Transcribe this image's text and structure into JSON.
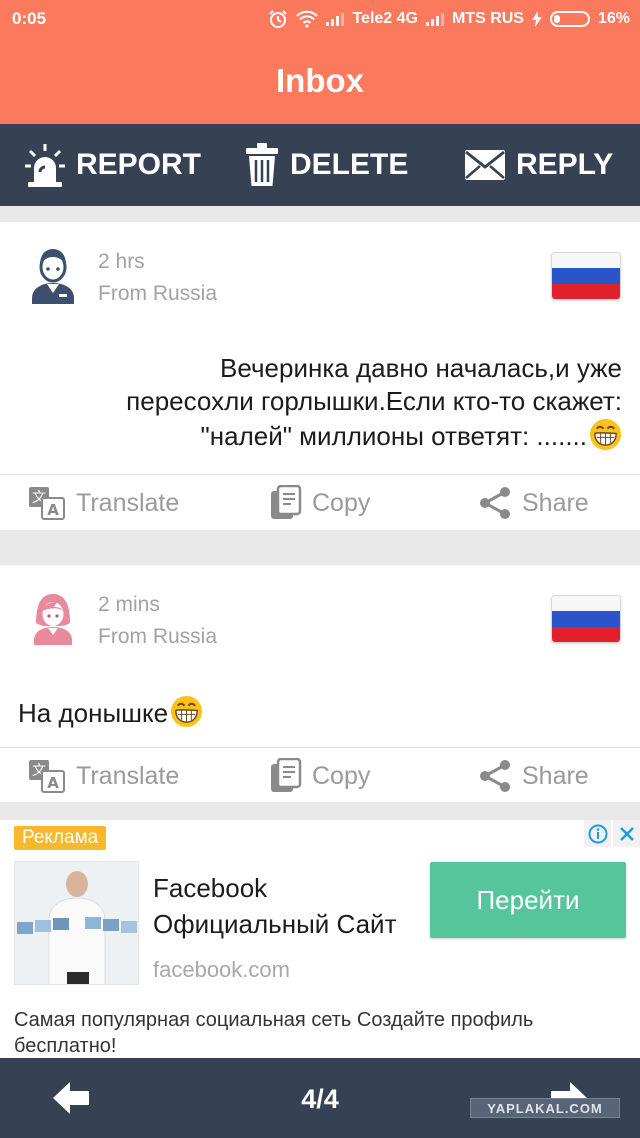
{
  "status_bar": {
    "time": "0:05",
    "carrier1": "Tele2 4G",
    "carrier2": "MTS RUS",
    "battery": "16%"
  },
  "header": {
    "title": "Inbox"
  },
  "toolbar": {
    "report_label": "REPORT",
    "delete_label": "DELETE",
    "reply_label": "REPLY"
  },
  "messages": [
    {
      "time": "2 hrs",
      "origin": "From Russia",
      "avatar": "male-user-icon",
      "flag": "russia-flag",
      "text_lines": [
        "Вечеринка давно началась,и уже",
        "пересохли горлышки.Если кто-то скажет:",
        "\"налей\" миллионы ответят: ......."
      ],
      "emoji": "grinning-face-emoji",
      "align": "right"
    },
    {
      "time": "2 mins",
      "origin": "From Russia",
      "avatar": "female-user-icon",
      "flag": "russia-flag",
      "text": "На донышке",
      "emoji": "grinning-face-emoji",
      "align": "left"
    }
  ],
  "card_actions": {
    "translate": "Translate",
    "copy": "Copy",
    "share": "Share"
  },
  "ad": {
    "badge": "Реклама",
    "headline_line1": "Facebook",
    "headline_line2": "Официальный Сайт",
    "domain": "facebook.com",
    "cta": "Перейти",
    "description": "Самая популярная социальная сеть Создайте профиль бесплатно!"
  },
  "pagination": {
    "page": "4/4"
  },
  "watermark": "YAPLAKAL.COM",
  "colors": {
    "header_bg": "#fb7a5e",
    "toolbar_bg": "#364254",
    "cta_green": "#55c59b",
    "ad_badge": "#f7b82b"
  }
}
